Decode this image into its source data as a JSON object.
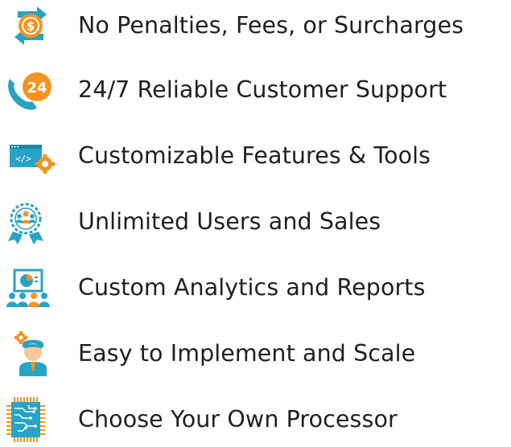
{
  "features": [
    {
      "label": "No Penalties, Fees, or Surcharges",
      "icon": "dollar-coin-arrows-icon"
    },
    {
      "label": "24/7 Reliable Customer Support",
      "icon": "phone-24-support-icon"
    },
    {
      "label": "Customizable Features & Tools",
      "icon": "code-window-gear-icon"
    },
    {
      "label": "Unlimited Users and Sales",
      "icon": "users-badge-ribbon-icon"
    },
    {
      "label": "Custom Analytics and Reports",
      "icon": "presentation-pie-chart-icon"
    },
    {
      "label": "Easy to Implement and Scale",
      "icon": "person-gear-icon"
    },
    {
      "label": "Choose Your Own Processor",
      "icon": "processor-chip-icon"
    }
  ],
  "colors": {
    "teal": "#29a3c4",
    "orange": "#f7931e",
    "text": "#1f1f1f",
    "skin": "#f6c89a"
  }
}
